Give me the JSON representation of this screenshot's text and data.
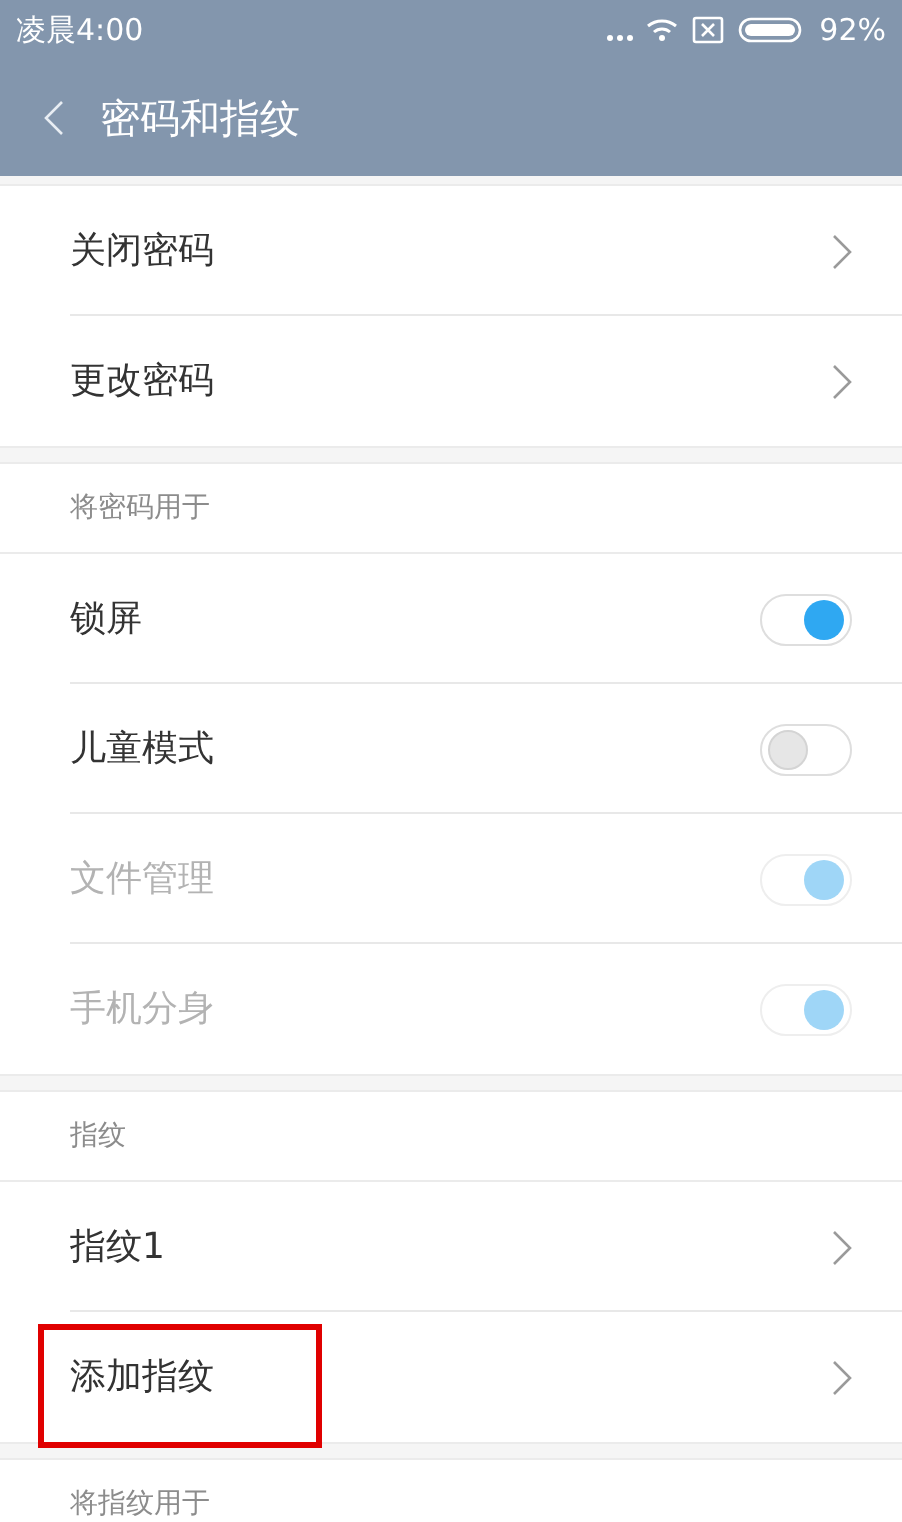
{
  "status_bar": {
    "time": "凌晨4:00",
    "battery": "92%"
  },
  "header": {
    "title": "密码和指纹"
  },
  "sections": [
    {
      "items": [
        {
          "kind": "link",
          "label": "关闭密码",
          "highlighted": false
        },
        {
          "kind": "link",
          "label": "更改密码",
          "highlighted": false
        }
      ]
    },
    {
      "title": "将密码用于",
      "items": [
        {
          "kind": "toggle",
          "label": "锁屏",
          "on": true,
          "disabled": false
        },
        {
          "kind": "toggle",
          "label": "儿童模式",
          "on": false,
          "disabled": false
        },
        {
          "kind": "toggle",
          "label": "文件管理",
          "on": true,
          "disabled": true
        },
        {
          "kind": "toggle",
          "label": "手机分身",
          "on": true,
          "disabled": true
        }
      ]
    },
    {
      "title": "指纹",
      "items": [
        {
          "kind": "link",
          "label": "指纹1",
          "highlighted": false
        },
        {
          "kind": "link",
          "label": "添加指纹",
          "highlighted": true
        }
      ]
    },
    {
      "title": "将指纹用于"
    }
  ]
}
